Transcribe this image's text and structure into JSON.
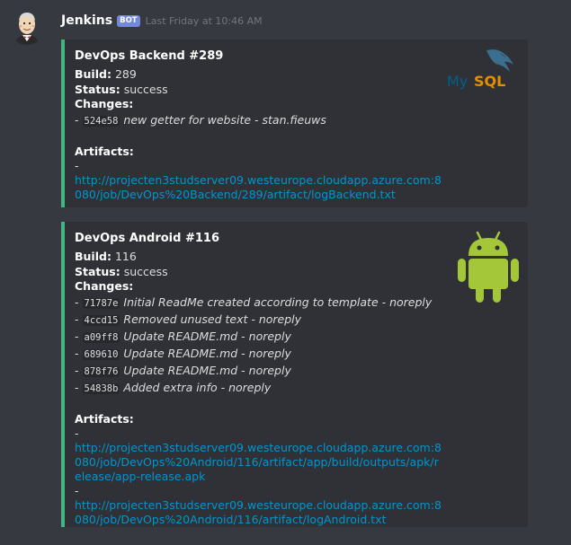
{
  "message": {
    "author": "Jenkins",
    "bot_tag": "BOT",
    "timestamp": "Last Friday at 10:46 AM",
    "avatar_icon": "jenkins-butler-icon"
  },
  "colors": {
    "embed_accent": "#43b581",
    "link": "#0096cf",
    "background": "#36393f",
    "embed_background": "#2f3136"
  },
  "embeds": [
    {
      "title": "DevOps Backend #289",
      "build_label": "Build:",
      "build_value": "289",
      "status_label": "Status:",
      "status_value": "success",
      "changes_label": "Changes:",
      "changes": [
        {
          "dash": "-",
          "hash": "524e58",
          "message": "new getter for website - stan.fieuws"
        }
      ],
      "artifacts_label": "Artifacts:",
      "artifacts": [
        {
          "dash": "-",
          "url": "http://projecten3studserver09.westeurope.cloudapp.azure.com:8080/job/DevOps%20Backend/289/artifact/logBackend.txt"
        }
      ],
      "thumbnail": "mysql-logo",
      "thumbnail_text_a": "My",
      "thumbnail_text_b": "SQL"
    },
    {
      "title": "DevOps Android #116",
      "build_label": "Build:",
      "build_value": "116",
      "status_label": "Status:",
      "status_value": "success",
      "changes_label": "Changes:",
      "changes": [
        {
          "dash": "-",
          "hash": "71787e",
          "message": "Initial ReadMe created according to template - noreply"
        },
        {
          "dash": "-",
          "hash": "4ccd15",
          "message": "Removed unused text - noreply"
        },
        {
          "dash": "-",
          "hash": "a09ff8",
          "message": "Update README.md - noreply"
        },
        {
          "dash": "-",
          "hash": "689610",
          "message": "Update README.md - noreply"
        },
        {
          "dash": "-",
          "hash": "878f76",
          "message": "Update README.md - noreply"
        },
        {
          "dash": "-",
          "hash": "54838b",
          "message": "Added extra info - noreply"
        }
      ],
      "artifacts_label": "Artifacts:",
      "artifacts": [
        {
          "dash": "-",
          "url": "http://projecten3studserver09.westeurope.cloudapp.azure.com:8080/job/DevOps%20Android/116/artifact/app/build/outputs/apk/release/app-release.apk"
        },
        {
          "dash": "-",
          "url": "http://projecten3studserver09.westeurope.cloudapp.azure.com:8080/job/DevOps%20Android/116/artifact/logAndroid.txt"
        }
      ],
      "thumbnail": "android-robot-logo"
    }
  ]
}
